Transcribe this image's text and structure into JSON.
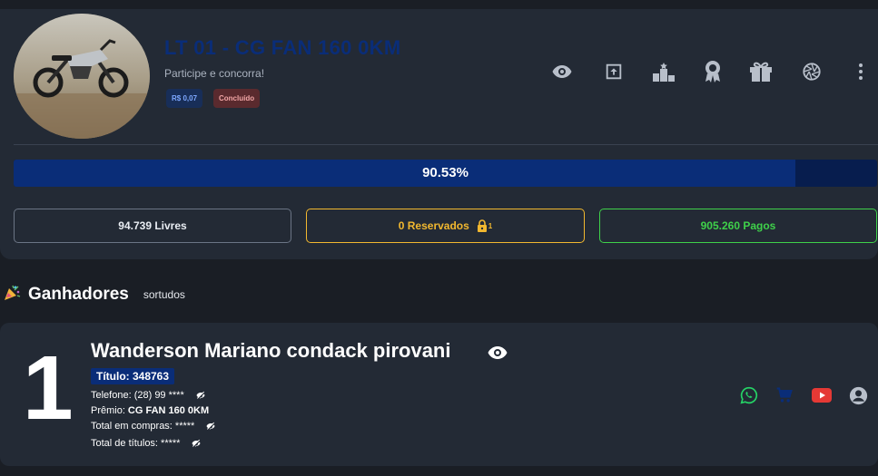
{
  "raffle": {
    "title": "LT 01 - CG FAN 160 0KM",
    "subtitle": "Participe e concorra!",
    "price_badge": "R$ 0,07",
    "status_badge": "Concluído",
    "progress_label": "90.53%",
    "progress_value": 0.9053
  },
  "header_icons": [
    "eye-icon",
    "upload-icon",
    "podium-icon",
    "award-icon",
    "gift-icon",
    "aperture-icon",
    "more-vert-icon"
  ],
  "stats": {
    "free": "94.739 Livres",
    "reserved": "0 Reservados",
    "reserved_lock_count": "1",
    "paid": "905.260 Pagos"
  },
  "winners_section": {
    "title": "Ganhadores",
    "subtitle": "sortudos"
  },
  "winner": {
    "rank": "1",
    "name": "Wanderson Mariano condack pirovani",
    "ticket": "Título: 348763",
    "phone": "Telefone: (28) 99 ****",
    "prize_label": "Prêmio: ",
    "prize_value": "CG FAN 160 0KM",
    "total_purchases": "Total em compras: *****",
    "total_titles": "Total de títulos: *****"
  },
  "winner_actions": [
    "whatsapp-icon",
    "cart-icon",
    "youtube-icon",
    "account-icon"
  ],
  "colors": {
    "accent": "#0a2d78",
    "reserved": "#f2b82f",
    "paid": "#3fd14a",
    "whatsapp": "#25d366",
    "youtube": "#e53935"
  }
}
